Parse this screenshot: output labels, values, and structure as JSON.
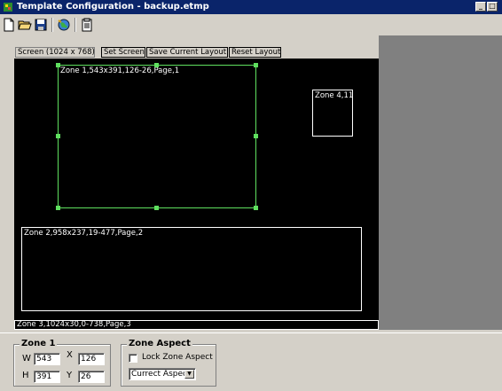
{
  "window": {
    "title": "Template Configuration - backup.etmp",
    "minimize": "_",
    "maximize": "□"
  },
  "toolbar": {
    "icons": [
      "new-file-icon",
      "open-folder-icon",
      "save-icon",
      "globe-icon",
      "properties-icon"
    ]
  },
  "layout_bar": {
    "screen_label": "Screen (1024 x 768)",
    "set_screen": "Set Screen",
    "save_layout": "Save Current Layout",
    "reset_layout": "Reset Layout"
  },
  "zones": [
    {
      "label": "Zone 1,543x391,126-26,Page,1",
      "selected": true
    },
    {
      "label": "Zone 4,11"
    },
    {
      "label": "Zone 2,958x237,19-477,Page,2"
    },
    {
      "label": "Zone 3,1024x30,0-738,Page,3"
    }
  ],
  "colors": {
    "title_bar": "#0a246a",
    "canvas": "#000000",
    "selected_zone_border": "#5fe05f",
    "zone_border": "#ffffff"
  },
  "zone_panel": {
    "title": "Zone 1",
    "w_label": "W",
    "w_value": "543",
    "x_label": "X",
    "x_value": "126",
    "h_label": "H",
    "h_value": "391",
    "y_label": "Y",
    "y_value": "26"
  },
  "aspect_panel": {
    "title": "Zone Aspect",
    "lock_label": "Lock Zone Aspect",
    "lock_checked": false,
    "aspect_value": "Currect Aspect"
  }
}
